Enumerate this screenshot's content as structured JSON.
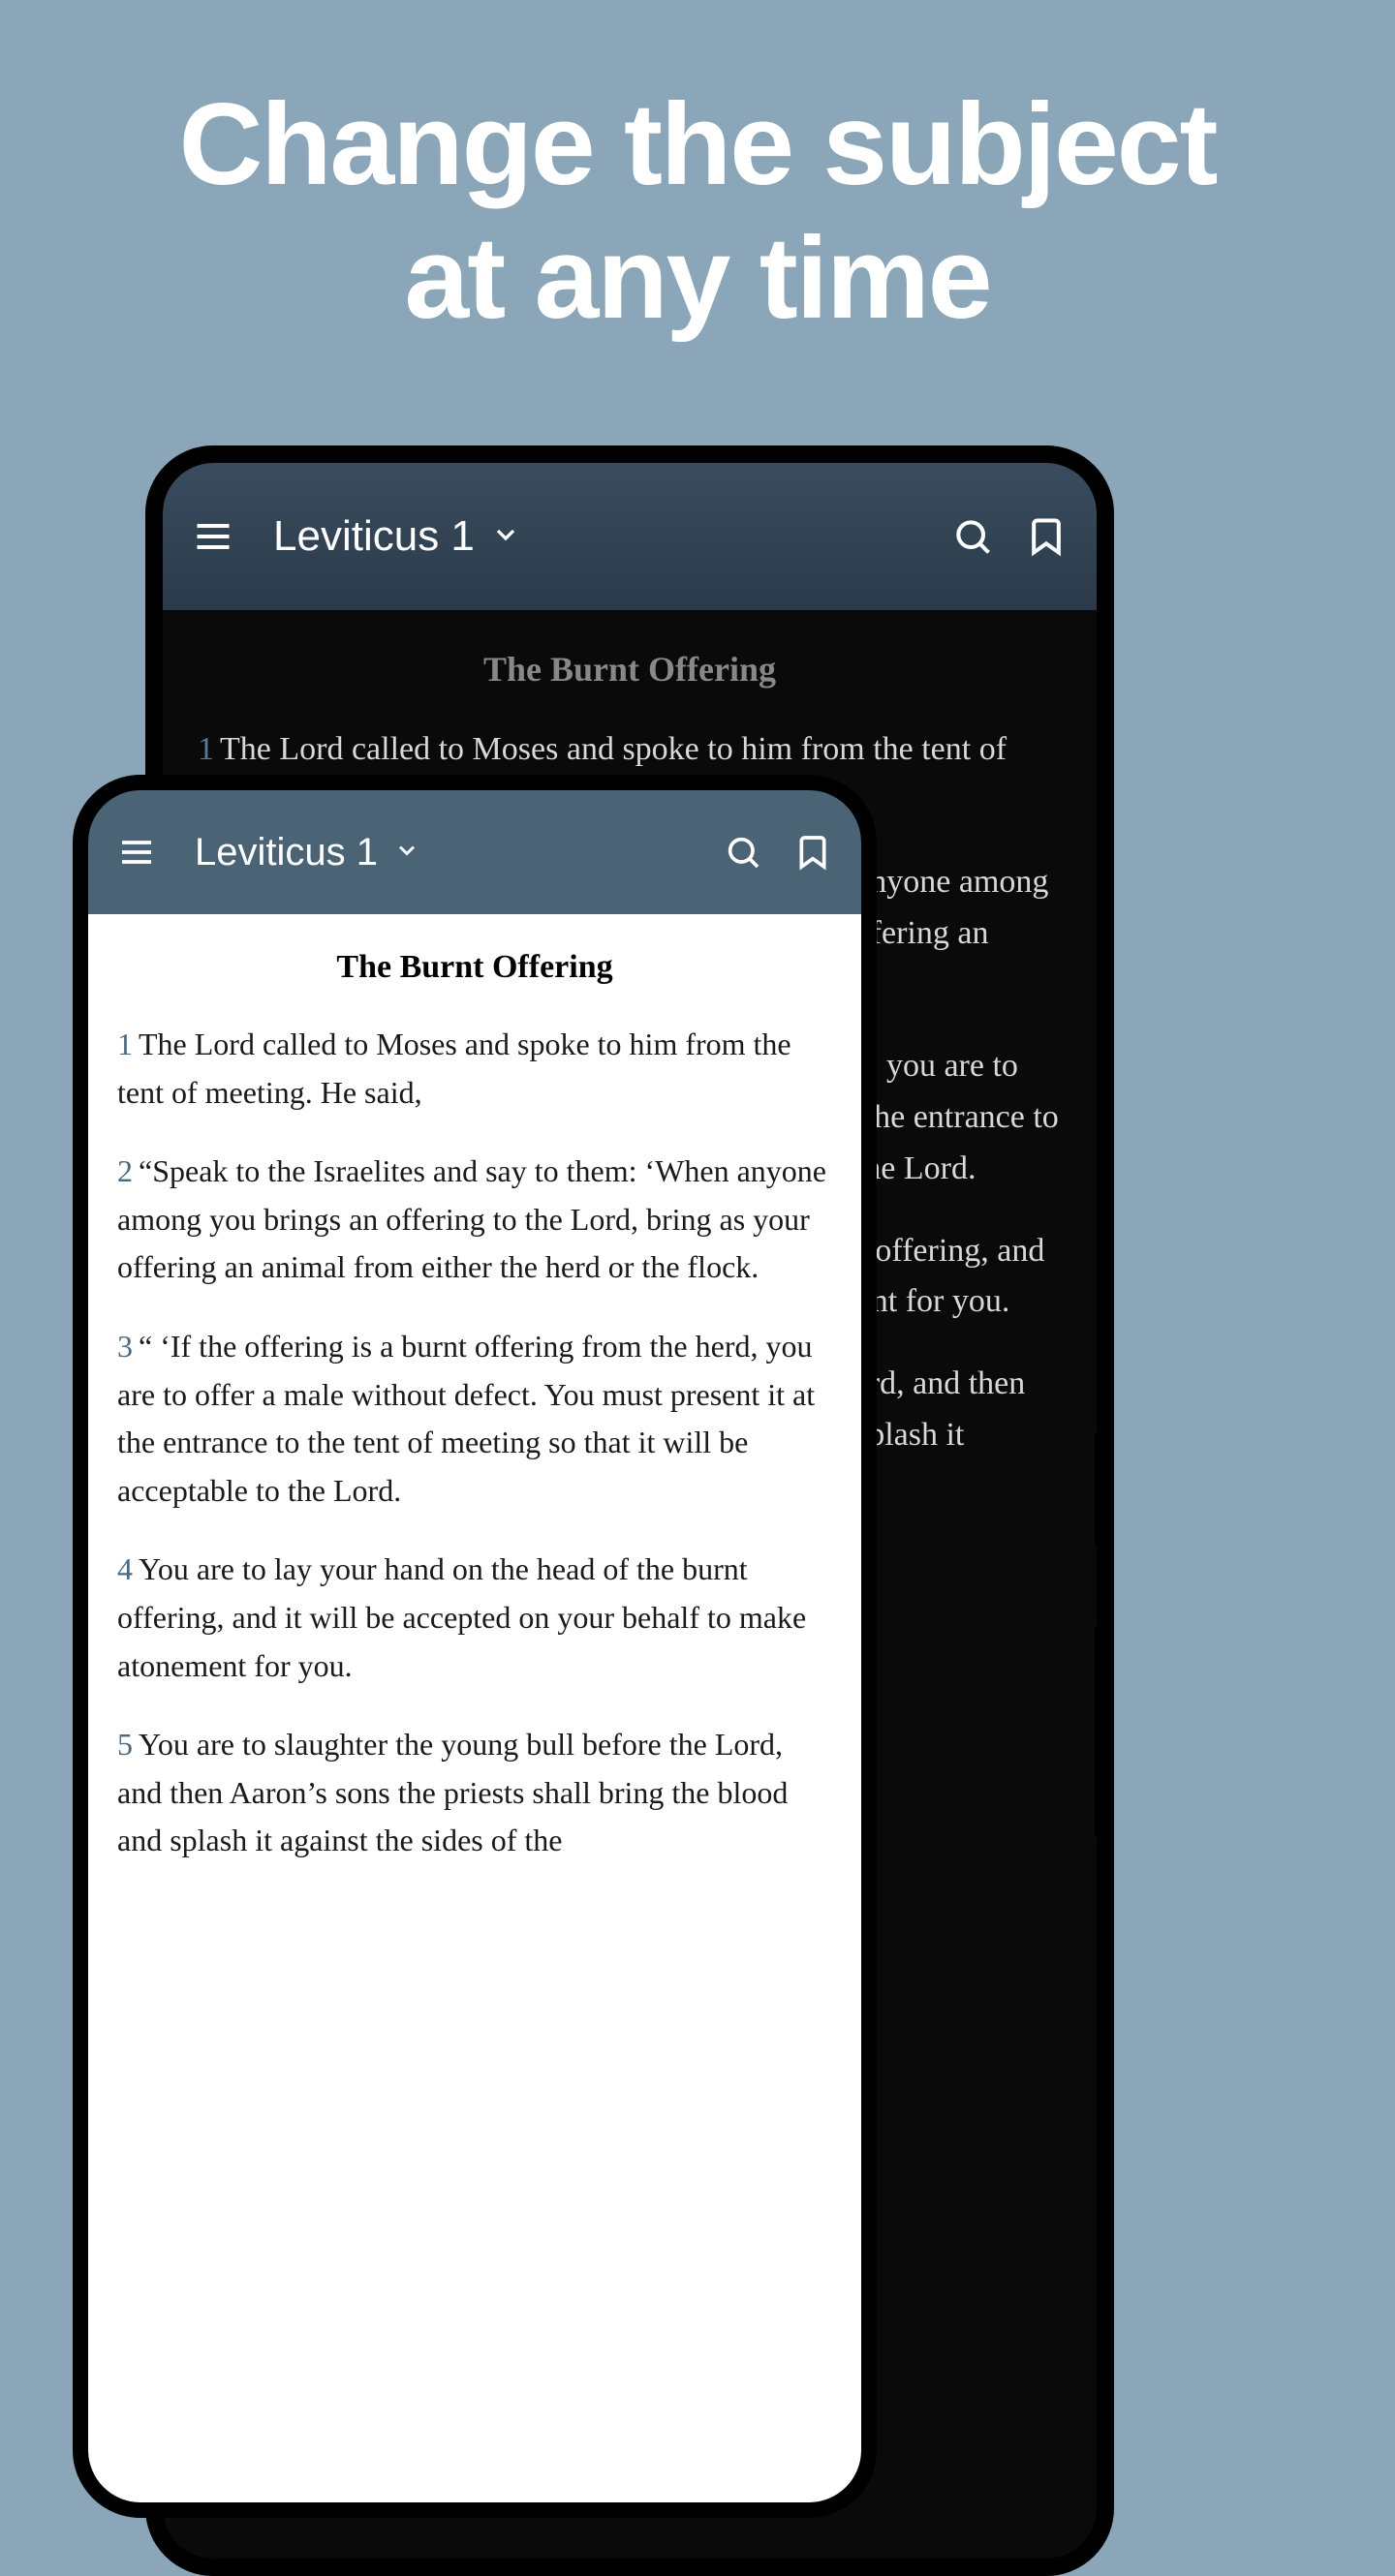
{
  "headline_line1": "Change the subject",
  "headline_line2": "at any time",
  "app": {
    "chapter_title": "Leviticus 1",
    "section_title": "The Burnt Offering",
    "verses": [
      {
        "num": "1",
        "text": "The Lord called to Moses and spoke to him from the tent of meeting. He said,"
      },
      {
        "num": "2",
        "text": "“Speak to the Israelites and say to them: ‘When anyone among you brings an offering to the Lord, bring as your offering an animal from either the herd or the flock."
      },
      {
        "num": "3",
        "text": "“ ‘If the offering is a burnt offering from the herd, you are to offer a male without defect. You must present it at the entrance to the tent of meeting so that it will be acceptable to the Lord."
      },
      {
        "num": "4",
        "text": "You are to lay your hand on the head of the burnt offering, and it will be accepted on your behalf to make atonement for you."
      },
      {
        "num": "5",
        "text": "You are to slaughter the young bull before the Lord, and then Aaron’s sons the priests shall bring the blood and splash it against the sides of the"
      }
    ]
  }
}
